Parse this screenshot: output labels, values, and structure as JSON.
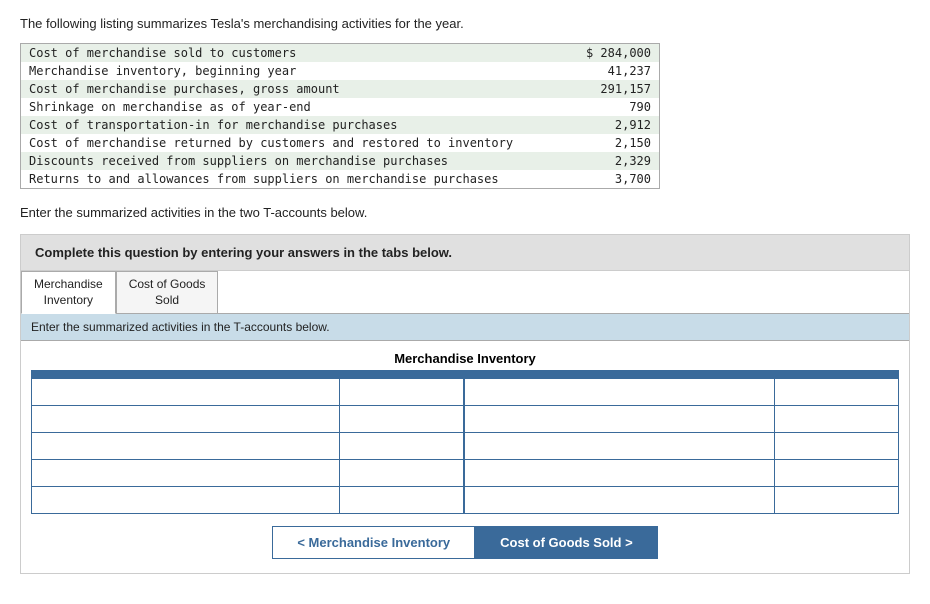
{
  "intro": {
    "text": "The following listing summarizes Tesla's merchandising activities for the year."
  },
  "data_table": {
    "rows": [
      {
        "label": "Cost of merchandise sold to customers",
        "value": "$ 284,000"
      },
      {
        "label": "Merchandise inventory, beginning year",
        "value": "41,237"
      },
      {
        "label": "Cost of merchandise purchases, gross amount",
        "value": "291,157"
      },
      {
        "label": "Shrinkage on merchandise as of year-end",
        "value": "790"
      },
      {
        "label": "Cost of transportation-in for merchandise purchases",
        "value": "2,912"
      },
      {
        "label": "Cost of merchandise returned by customers and restored to inventory",
        "value": "2,150"
      },
      {
        "label": "Discounts received from suppliers on merchandise purchases",
        "value": "2,329"
      },
      {
        "label": "Returns to and allowances from suppliers on merchandise purchases",
        "value": "3,700"
      }
    ]
  },
  "enter_text": "Enter the summarized activities in the two T-accounts below.",
  "question_box": {
    "text": "Complete this question by entering your answers in the tabs below."
  },
  "tabs": [
    {
      "id": "merchandise-inventory",
      "line1": "Merchandise",
      "line2": "Inventory"
    },
    {
      "id": "cost-of-goods-sold",
      "line1": "Cost of Goods",
      "line2": "Sold"
    }
  ],
  "active_tab": "merchandise-inventory",
  "tab_instruction": "Enter the summarized activities in the T-accounts below.",
  "t_account": {
    "title": "Merchandise Inventory",
    "rows": 5
  },
  "nav_buttons": {
    "prev_label": "< Merchandise Inventory",
    "next_label": "Cost of Goods Sold >"
  }
}
